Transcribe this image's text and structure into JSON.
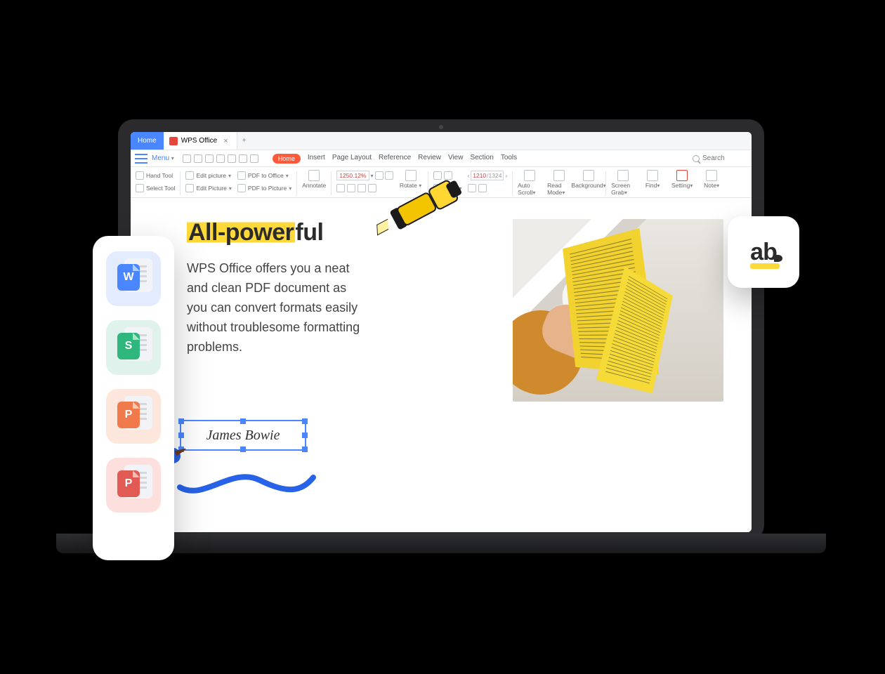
{
  "titlebar": {
    "home_tab": "Home",
    "doc_tab": "WPS Office",
    "close": "×",
    "add": "+"
  },
  "menubar": {
    "menu": "Menu",
    "tabs": [
      "Home",
      "Insert",
      "Page Layout",
      "Reference",
      "Review",
      "View",
      "Section",
      "Tools"
    ],
    "active_index": 0,
    "search_placeholder": "Search"
  },
  "ribbon": {
    "col1": [
      {
        "label": "Hand Tool"
      },
      {
        "label": "Select Tool"
      }
    ],
    "col2": [
      {
        "label": "Edit picture"
      },
      {
        "label": "Edit Picture"
      }
    ],
    "col3": [
      {
        "label": "PDF to Office"
      },
      {
        "label": "PDF to Picture"
      }
    ],
    "annotate": "Annotate",
    "zoom": {
      "value": "1250.12%"
    },
    "rotate": "Rotate",
    "page": {
      "current": "1210",
      "total": "/1324"
    },
    "buttons": [
      "Auto Scroll",
      "Read Mode",
      "Background",
      "Screen Grab",
      "Find",
      "Setting",
      "Note"
    ]
  },
  "doc": {
    "headline_hl": "All-power",
    "headline_rest": "ful",
    "body": "WPS Office offers you a neat and clean PDF document as you can convert formats easily without troublesome formatting problems.",
    "signature": "James Bowie"
  },
  "sidebar": {
    "apps": [
      {
        "letter": "W",
        "name": "writer"
      },
      {
        "letter": "S",
        "name": "spreadsheet"
      },
      {
        "letter": "P",
        "name": "presentation"
      },
      {
        "letter": "P",
        "name": "pdf"
      }
    ]
  },
  "ab": {
    "text": "ab"
  }
}
